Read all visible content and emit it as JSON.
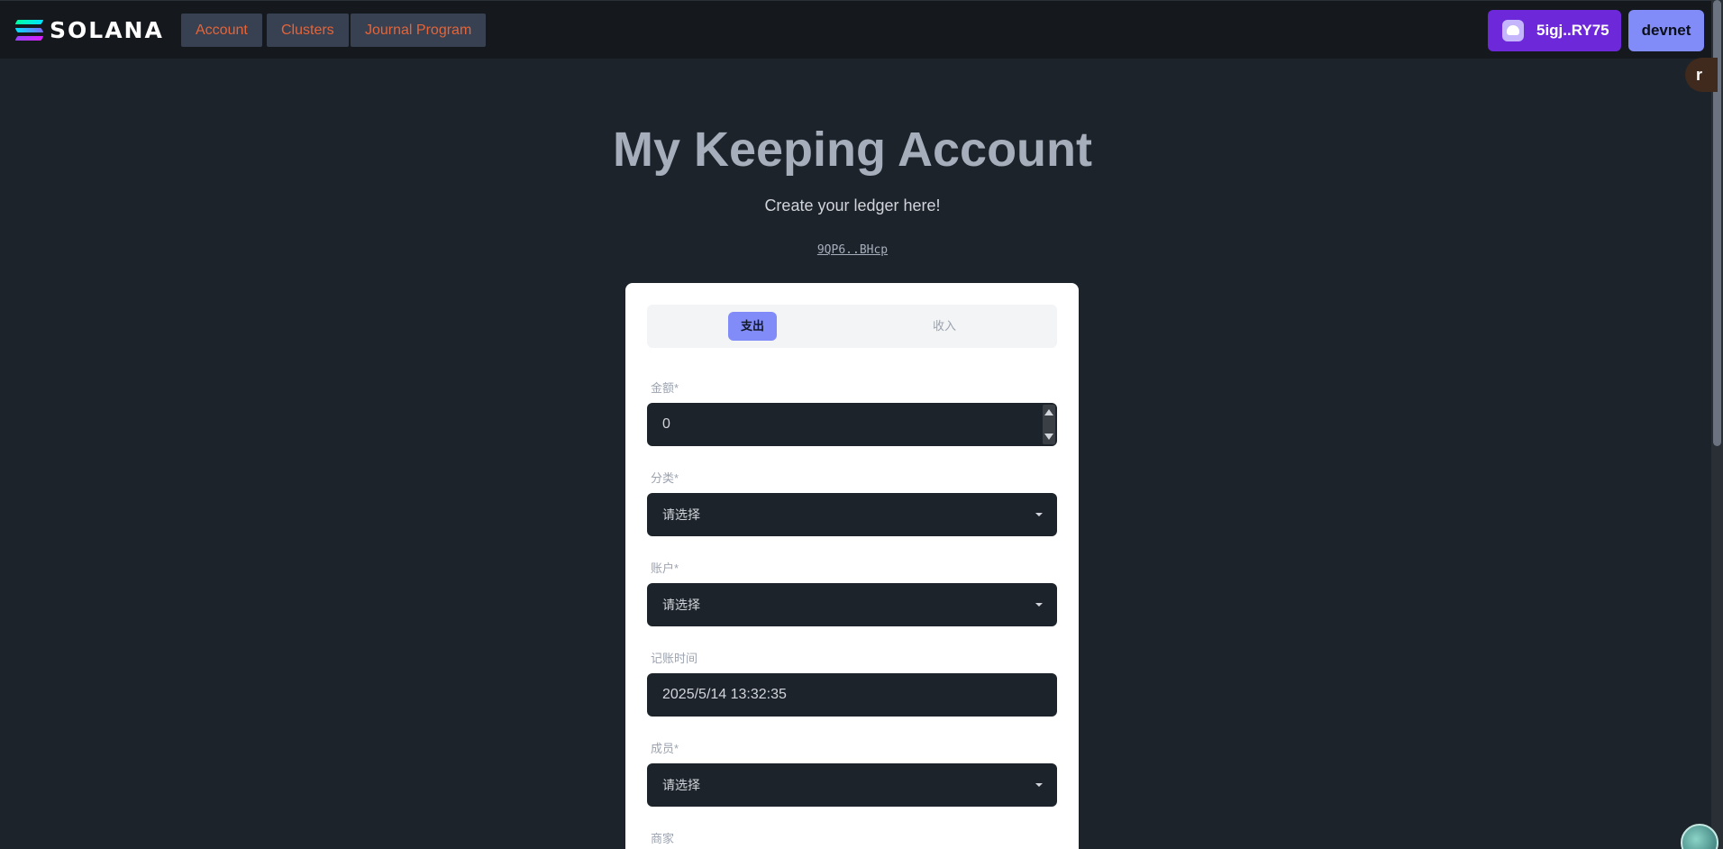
{
  "nav": {
    "brand": "SOLANA",
    "links": [
      "Account",
      "Clusters",
      "Journal Program"
    ],
    "wallet_label": "5igj..RY75",
    "cluster_label": "devnet"
  },
  "floating": {
    "side_badge": "r"
  },
  "hero": {
    "title": "My Keeping Account",
    "subtitle": "Create your ledger here!",
    "address": "9QP6..BHcp"
  },
  "form": {
    "tabs": {
      "active": "支出",
      "inactive": "收入"
    },
    "amount": {
      "label": "金额*",
      "value": "0"
    },
    "category": {
      "label": "分类*",
      "value": "请选择"
    },
    "account": {
      "label": "账户*",
      "value": "请选择"
    },
    "time": {
      "label": "记账时间",
      "value": "2025/5/14 13:32:35"
    },
    "member": {
      "label": "成员*",
      "value": "请选择"
    },
    "merchant": {
      "label": "商家"
    }
  },
  "colors": {
    "background": "#1d232a",
    "topbar": "#15191e",
    "nav_link_text": "#e5643a",
    "wallet_button": "#6d28d9",
    "cluster_button": "#818cf8",
    "active_tab": "#818cf8"
  }
}
